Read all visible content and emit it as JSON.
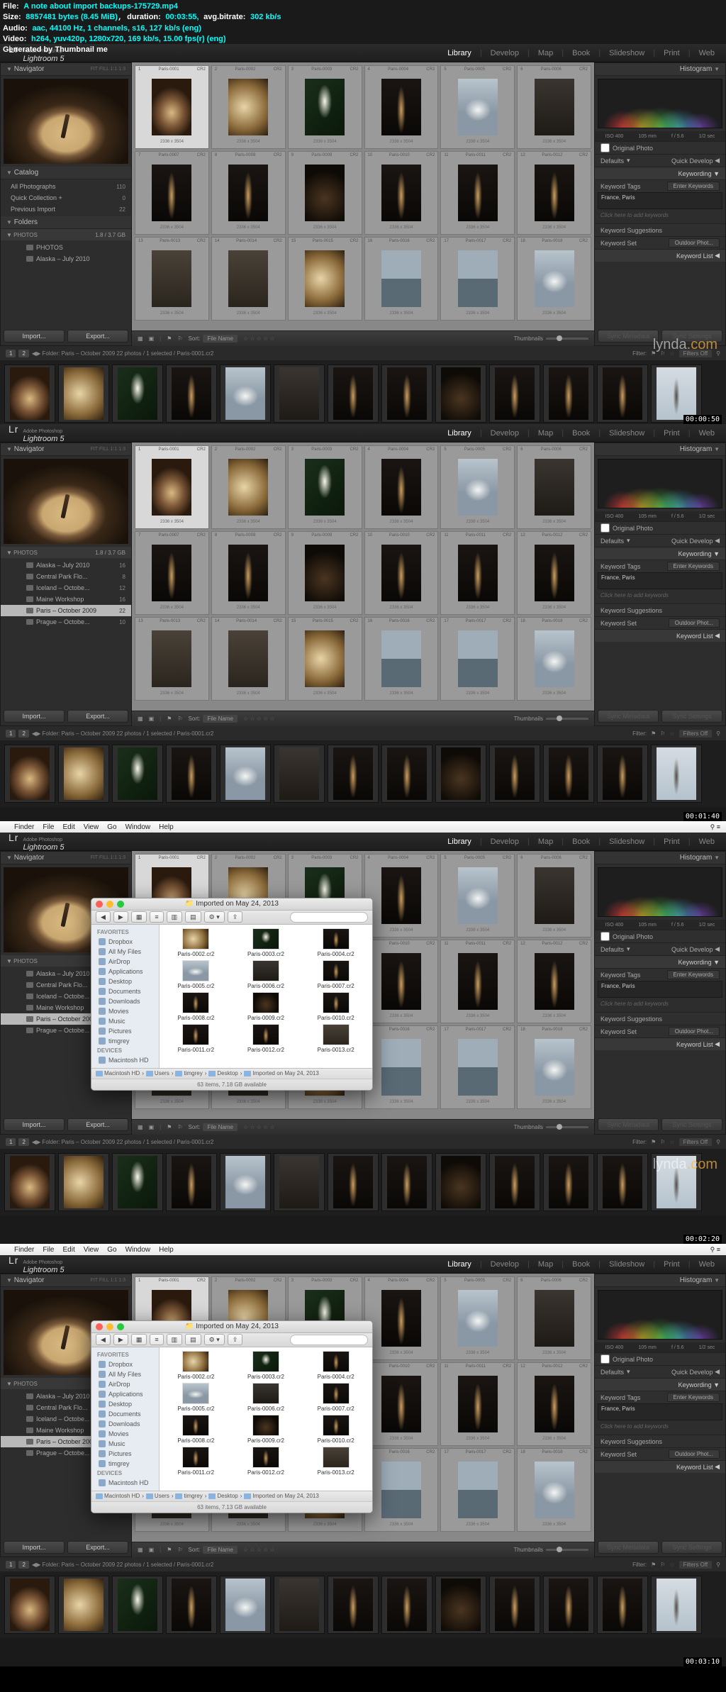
{
  "overlay": {
    "file_label": "File:",
    "file": "A note about import backups-175729.mp4",
    "size_label": "Size:",
    "size": "8857481 bytes (8.45 MiB)",
    "duration_label": "duration:",
    "duration": "00:03:55,",
    "bitrate_label": "avg.bitrate:",
    "bitrate": "302 kb/s",
    "audio_label": "Audio:",
    "audio": "aac, 44100 Hz, 1 channels, s16, 127 kb/s (eng)",
    "video_label": "Video:",
    "video": "h264, yuv420p, 1280x720, 169 kb/s, 15.00 fps(r) (eng)",
    "gen": "Generated by Thumbnail me"
  },
  "lr": {
    "brand_small": "Adobe Photoshop",
    "brand": "Lightroom 5",
    "modules": [
      "Library",
      "Develop",
      "Map",
      "Book",
      "Slideshow",
      "Print",
      "Web"
    ],
    "navigator": "Navigator",
    "nav_sub": "FIT  FILL  1:1  1:3",
    "catalog": "Catalog",
    "cat_items": [
      {
        "l": "All Photographs",
        "c": "110"
      },
      {
        "l": "Quick Collection +",
        "c": "0"
      },
      {
        "l": "Previous Import",
        "c": "22"
      }
    ],
    "folders": "Folders",
    "photos_hdr": "PHOTOS",
    "photos_size": "1.8 / 3.7 GB",
    "folder_short": [
      {
        "l": "PHOTOS",
        "c": ""
      },
      {
        "l": "Alaska – July 2010",
        "c": ""
      }
    ],
    "folder_long": [
      {
        "l": "Alaska – July 2010",
        "c": "16"
      },
      {
        "l": "Central Park Flo...",
        "c": "8"
      },
      {
        "l": "Iceland – Octobe...",
        "c": "12"
      },
      {
        "l": "Maine Workshop",
        "c": "16"
      },
      {
        "l": "Paris – October 2009",
        "c": "22"
      },
      {
        "l": "Prague – Octobe...",
        "c": "10"
      }
    ],
    "folder_long2": [
      {
        "l": "Alaska – July 2010",
        "c": ""
      },
      {
        "l": "Central Park Flo...",
        "c": ""
      },
      {
        "l": "Iceland – Octobe...",
        "c": ""
      },
      {
        "l": "Maine Workshop",
        "c": ""
      },
      {
        "l": "Paris – October 2009",
        "c": ""
      },
      {
        "l": "Prague – Octobe...",
        "c": ""
      }
    ],
    "import": "Import...",
    "export": "Export...",
    "toolbar_sort": "Sort:",
    "toolbar_sortval": "File Name",
    "toolbar_thumbs": "Thumbnails",
    "filmstrip_info": "Folder: Paris – October 2009    22 photos / 1 selected / Paris-0001.cr2",
    "filter": "Filter:",
    "filters_off": "Filters Off",
    "histogram": "Histogram",
    "histo_info": [
      "ISO 400",
      "105 mm",
      "f / 5.6",
      "1/2 sec"
    ],
    "orig_photo": "Original Photo",
    "defaults": "Defaults",
    "quickdev": "Quick Develop",
    "keywording": "Keywording",
    "kw_tags": "Keyword Tags",
    "kw_enter": "Enter Keywords",
    "kw_val": "France, Paris",
    "kw_click": "Click here to add keywords",
    "kw_sugg": "Keyword Suggestions",
    "kw_set": "Keyword Set",
    "kw_setval": "Outdoor Phot...",
    "kw_list": "Keyword List",
    "sync_meta": "Sync Metadata",
    "sync_set": "Sync Settings"
  },
  "grid": [
    {
      "n": "1",
      "f": "Paris-0001",
      "ext": "CR2",
      "cls": "th-crepe",
      "sel": true
    },
    {
      "n": "2",
      "f": "Paris-0002",
      "ext": "CR2",
      "cls": "th-food"
    },
    {
      "n": "3",
      "f": "Paris-0003",
      "ext": "CR2",
      "cls": "th-calla"
    },
    {
      "n": "4",
      "f": "Paris-0004",
      "ext": "CR2",
      "cls": "th-eiffel-dark"
    },
    {
      "n": "5",
      "f": "Paris-0005",
      "ext": "CR2",
      "cls": "th-sacre"
    },
    {
      "n": "6",
      "f": "Paris-0006",
      "ext": "CR2",
      "cls": "th-street"
    },
    {
      "n": "7",
      "f": "Paris-0007",
      "ext": "CR2",
      "cls": "th-eiffel-dark"
    },
    {
      "n": "8",
      "f": "Paris-0008",
      "ext": "CR2",
      "cls": "th-eiffel-dark"
    },
    {
      "n": "9",
      "f": "Paris-0009",
      "ext": "CR2",
      "cls": "th-night"
    },
    {
      "n": "10",
      "f": "Paris-0010",
      "ext": "CR2",
      "cls": "th-eiffel-dark"
    },
    {
      "n": "11",
      "f": "Paris-0011",
      "ext": "CR2",
      "cls": "th-eiffel-dark"
    },
    {
      "n": "12",
      "f": "Paris-0012",
      "ext": "CR2",
      "cls": "th-eiffel-dark"
    },
    {
      "n": "13",
      "f": "Paris-0013",
      "ext": "CR2",
      "cls": "th-misc"
    },
    {
      "n": "14",
      "f": "Paris-0014",
      "ext": "CR2",
      "cls": "th-misc"
    },
    {
      "n": "15",
      "f": "Paris-0015",
      "ext": "CR2",
      "cls": "th-food"
    },
    {
      "n": "16",
      "f": "Paris-0016",
      "ext": "CR2",
      "cls": "th-boat"
    },
    {
      "n": "17",
      "f": "Paris-0017",
      "ext": "CR2",
      "cls": "th-boat"
    },
    {
      "n": "18",
      "f": "Paris-0018",
      "ext": "CR2",
      "cls": "th-sacre"
    }
  ],
  "film": [
    "th-crepe",
    "th-food",
    "th-calla",
    "th-eiffel-dark",
    "th-sacre",
    "th-street",
    "th-eiffel-dark",
    "th-eiffel-dark",
    "th-night",
    "th-eiffel-dark",
    "th-eiffel-dark",
    "th-eiffel-dark",
    "th-eiffel-day"
  ],
  "menubar": {
    "items": [
      "Finder",
      "File",
      "Edit",
      "View",
      "Go",
      "Window",
      "Help"
    ]
  },
  "finder": {
    "title": "Imported on May 24, 2013",
    "fav": "FAVORITES",
    "dev": "DEVICES",
    "sidebar": [
      "Dropbox",
      "All My Files",
      "AirDrop",
      "Applications",
      "Desktop",
      "Documents",
      "Downloads",
      "Movies",
      "Music",
      "Pictures",
      "timgrey"
    ],
    "sidebar_dev": [
      "Macintosh HD"
    ],
    "files": [
      "Paris-0002.cr2",
      "Paris-0003.cr2",
      "Paris-0004.cr2",
      "Paris-0005.cr2",
      "Paris-0006.cr2",
      "Paris-0007.cr2",
      "Paris-0008.cr2",
      "Paris-0009.cr2",
      "Paris-0010.cr2",
      "Paris-0011.cr2",
      "Paris-0012.cr2",
      "Paris-0013.cr2"
    ],
    "file_cls": [
      "th-food",
      "th-calla",
      "th-eiffel-dark",
      "th-sacre",
      "th-street",
      "th-eiffel-dark",
      "th-eiffel-dark",
      "th-night",
      "th-eiffel-dark",
      "th-eiffel-dark",
      "th-eiffel-dark",
      "th-misc"
    ],
    "path": [
      "Macintosh HD",
      "Users",
      "timgrey",
      "Desktop",
      "Imported on May 24, 2013"
    ],
    "status3": "63 items, 7.18 GB available",
    "status4": "63 items, 7.13 GB available"
  },
  "timestamps": [
    "00:00:50",
    "00:01:40",
    "00:02:20",
    "00:03:10"
  ],
  "watermark": {
    "a": "lynda",
    "b": ".com"
  }
}
